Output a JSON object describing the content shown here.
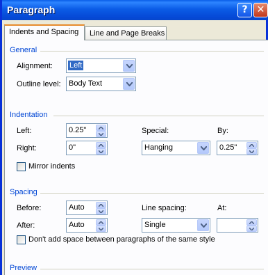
{
  "window": {
    "title": "Paragraph",
    "help_button": "?",
    "close_button": "✕"
  },
  "tabs": [
    {
      "label": "Indents and Spacing",
      "active": true
    },
    {
      "label": "Line and Page Breaks",
      "active": false
    }
  ],
  "general": {
    "heading": "General",
    "alignment_label": "Alignment:",
    "alignment_value": "Left",
    "outline_label": "Outline level:",
    "outline_value": "Body Text"
  },
  "indentation": {
    "heading": "Indentation",
    "left_label": "Left:",
    "left_value": "0.25\"",
    "right_label": "Right:",
    "right_value": "0\"",
    "special_label": "Special:",
    "special_value": "Hanging",
    "by_label": "By:",
    "by_value": "0.25\"",
    "mirror_label": "Mirror indents"
  },
  "spacing": {
    "heading": "Spacing",
    "before_label": "Before:",
    "before_value": "Auto",
    "after_label": "After:",
    "after_value": "Auto",
    "line_spacing_label": "Line spacing:",
    "line_spacing_value": "Single",
    "at_label": "At:",
    "at_value": "",
    "dont_add_label": "Don't add space between paragraphs of the same style"
  },
  "preview": {
    "heading": "Preview"
  },
  "colors": {
    "title_bar": "#0a5fe8",
    "group_heading": "#0046d5",
    "selection": "#316ac5",
    "dialog_bg": "#ece9d8"
  }
}
